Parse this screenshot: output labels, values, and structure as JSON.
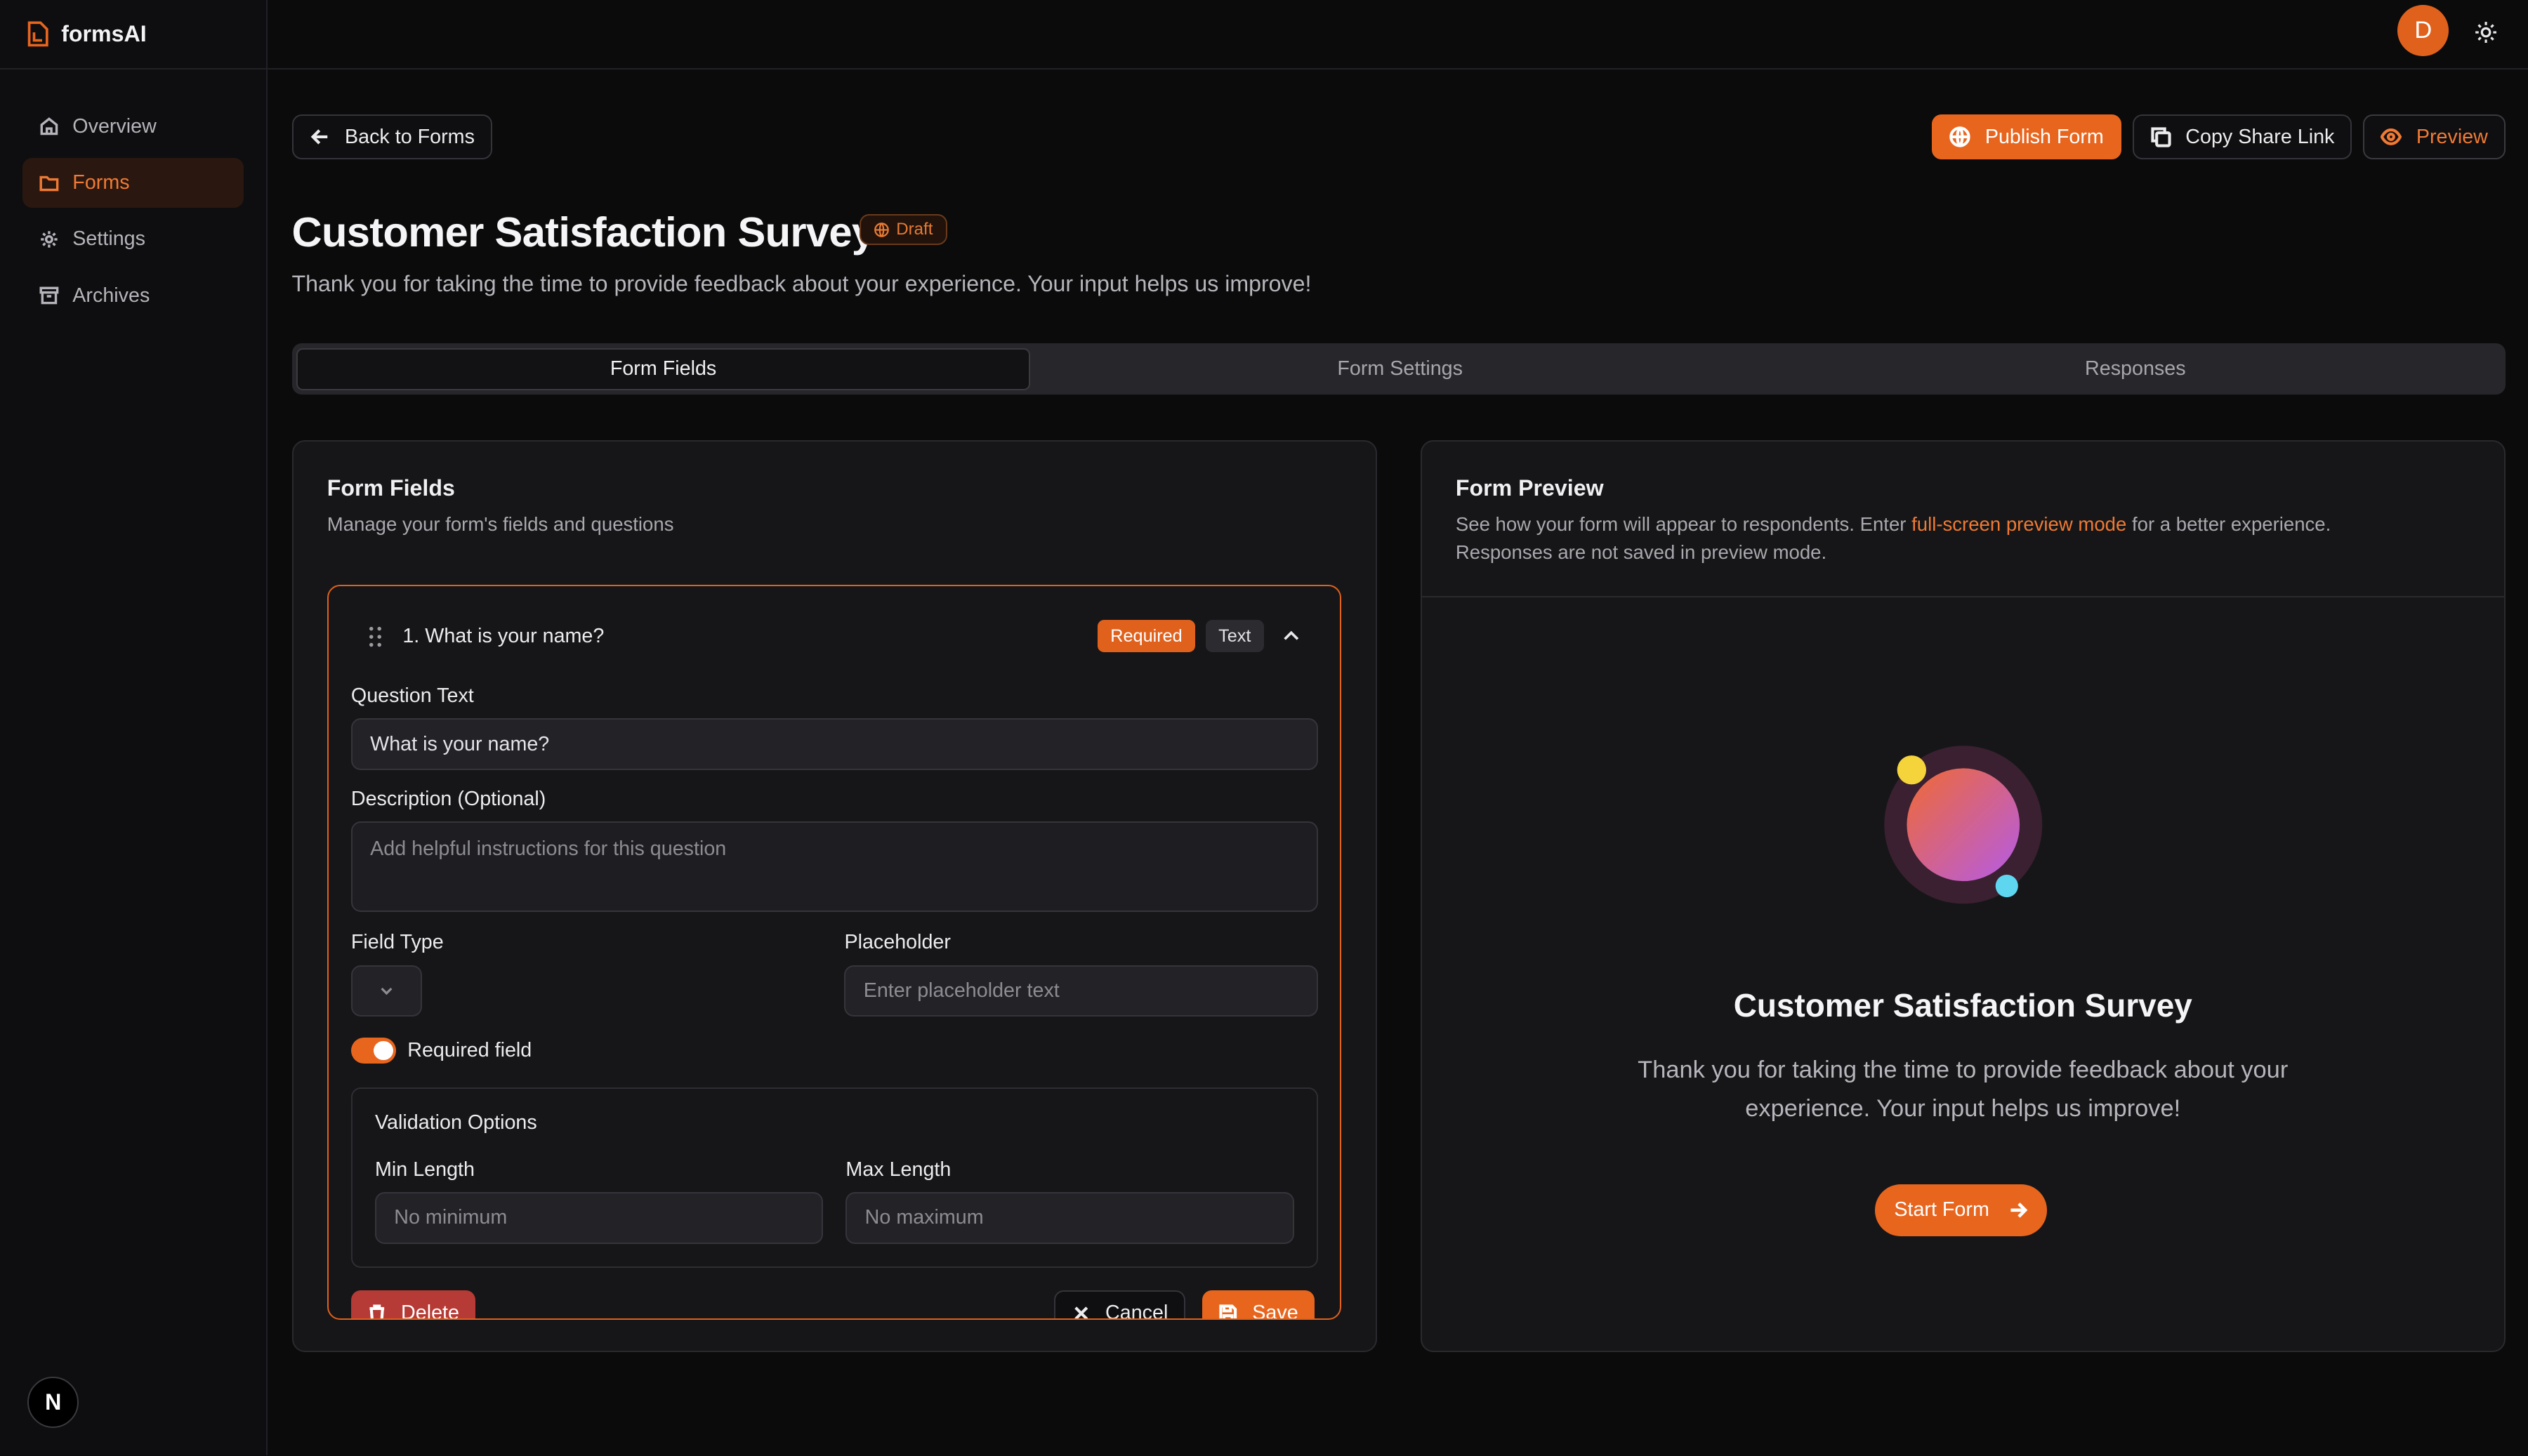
{
  "app": {
    "name": "formsAI",
    "avatar_initial": "D",
    "corner_badge": "N"
  },
  "sidebar": {
    "items": [
      {
        "label": "Overview",
        "icon": "home-icon"
      },
      {
        "label": "Forms",
        "icon": "folder-icon",
        "active": true
      },
      {
        "label": "Settings",
        "icon": "gear-icon"
      },
      {
        "label": "Archives",
        "icon": "archive-icon"
      }
    ]
  },
  "header": {
    "back_label": "Back to Forms",
    "publish_label": "Publish Form",
    "copy_label": "Copy Share Link",
    "preview_label": "Preview"
  },
  "form": {
    "title": "Customer Satisfaction Survey",
    "status": "Draft",
    "description": "Thank you for taking the time to provide feedback about your experience. Your input helps us improve!"
  },
  "tabs": [
    "Form Fields",
    "Form Settings",
    "Responses"
  ],
  "fields_card": {
    "title": "Form Fields",
    "description": "Manage your form's fields and questions",
    "question": {
      "heading": "1. What is your name?",
      "required_chip": "Required",
      "type_chip": "Text",
      "question_text_label": "Question Text",
      "question_text_value": "What is your name?",
      "description_label": "Description (Optional)",
      "description_placeholder": "Add helpful instructions for this question",
      "field_type_label": "Field Type",
      "placeholder_label": "Placeholder",
      "placeholder_placeholder": "Enter placeholder text",
      "required_toggle_label": "Required field",
      "required_on": true,
      "validation_title": "Validation Options",
      "min_label": "Min Length",
      "min_placeholder": "No minimum",
      "max_label": "Max Length",
      "max_placeholder": "No maximum",
      "delete_label": "Delete",
      "cancel_label": "Cancel",
      "save_label": "Save"
    }
  },
  "preview_card": {
    "title": "Form Preview",
    "desc_before": "See how your form will appear to respondents. Enter ",
    "desc_link": "full-screen preview mode",
    "desc_after": " for a better experience.",
    "desc_line2": "Responses are not saved in preview mode.",
    "start_label": "Start Form"
  },
  "colors": {
    "accent": "#e8651e",
    "background": "#0b0b0c",
    "card": "#161618",
    "danger": "#b63a35"
  }
}
